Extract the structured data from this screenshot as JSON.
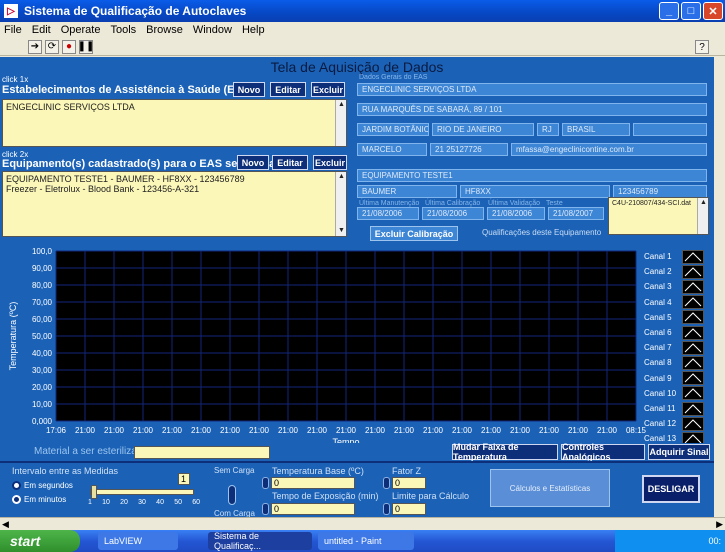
{
  "window": {
    "title": "Sistema de Qualificação de Autoclaves"
  },
  "menu": [
    "File",
    "Edit",
    "Operate",
    "Tools",
    "Browse",
    "Window",
    "Help"
  ],
  "panel": {
    "title": "Tela de Aquisição de Dados",
    "eas": {
      "hint": "click 1x",
      "heading": "Estabelecimentos de Assistência à Saúde (EAS)",
      "buttons": {
        "novo": "Novo",
        "editar": "Editar",
        "excluir": "Excluir"
      },
      "items": [
        "ENGECLINIC SERVIÇOS LTDA"
      ],
      "details_label": "Dados Gerais do EAS",
      "name": "ENGECLINIC SERVIÇOS LTDA",
      "address": "RUA MARQUÊS DE SABARÁ, 89 / 101",
      "district": "JARDIM BOTÂNICO",
      "city": "RIO DE JANEIRO",
      "state": "RJ",
      "country": "BRASIL",
      "contact": "MARCELO",
      "phone": "21 25127726",
      "email": "mfassa@engeclinicontine.com.br"
    },
    "equipment": {
      "hint": "click 2x",
      "heading": "Equipamento(s) cadastrado(s) para o EAS selecionado",
      "buttons": {
        "novo": "Novo",
        "editar": "Editar",
        "excluir": "Excluir"
      },
      "items": [
        "EQUIPAMENTO TESTE1 - BAUMER - HF8XX - 123456789",
        "Freezer - Eletrolux - Blood Bank - 123456-A-321"
      ],
      "name": "EQUIPAMENTO TESTE1",
      "brand": "BAUMER",
      "model": "HF8XX",
      "serial": "123456789",
      "date_labels": [
        "Última Manutenção",
        "Última Calibração",
        "Última Validação",
        "Teste"
      ],
      "dates": [
        "21/08/2006",
        "21/08/2006",
        "21/08/2006",
        "21/08/2007"
      ],
      "file_list": [
        "C4U-210807/434-SCI.dat"
      ],
      "excluir_calibracao": "Excluir Calibração",
      "qualificacoes_label": "Qualificações deste Equipamento"
    }
  },
  "chart_data": {
    "type": "line",
    "ylabel": "Temperatura (ºC)",
    "xlabel": "Tempo",
    "ylim": [
      0,
      100
    ],
    "y_ticks": [
      "0,000",
      "10,00",
      "20,00",
      "30,00",
      "40,00",
      "50,00",
      "60,00",
      "70,00",
      "80,00",
      "90,00",
      "100,0"
    ],
    "x_ticks": [
      "17:06",
      "21:00",
      "21:00",
      "21:00",
      "21:00",
      "21:00",
      "21:00",
      "21:00",
      "21:00",
      "21:00",
      "21:00",
      "21:00",
      "21:00",
      "21:00",
      "21:00",
      "21:00",
      "21:00",
      "21:00",
      "21:00",
      "21:00",
      "08:15"
    ],
    "grid": true,
    "series": [
      {
        "name": "Canal 1",
        "values": []
      },
      {
        "name": "Canal 2",
        "values": []
      },
      {
        "name": "Canal 3",
        "values": []
      },
      {
        "name": "Canal 4",
        "values": []
      },
      {
        "name": "Canal 5",
        "values": []
      },
      {
        "name": "Canal 6",
        "values": []
      },
      {
        "name": "Canal 7",
        "values": []
      },
      {
        "name": "Canal 8",
        "values": []
      },
      {
        "name": "Canal 9",
        "values": []
      },
      {
        "name": "Canal 10",
        "values": []
      },
      {
        "name": "Canal 11",
        "values": []
      },
      {
        "name": "Canal 12",
        "values": []
      },
      {
        "name": "Canal 13",
        "values": []
      }
    ],
    "legend": "right"
  },
  "below_chart": {
    "material_label": "Material a ser esterilizado",
    "material_value": "",
    "btn_faixa": "Mudar Faixa de Temperatura",
    "btn_controles": "Controles Analógicos",
    "btn_adquirir": "Adquirir Sinal"
  },
  "controls": {
    "intervalo_label": "Intervalo entre as Medidas",
    "radio_seg": "Em segundos",
    "radio_min": "Em minutos",
    "slider_value": "1",
    "slider_value_fraction": 0.0,
    "slider_ticks": [
      "1",
      "10",
      "20",
      "30",
      "40",
      "50",
      "60"
    ],
    "sem_carga": "Sem Carga",
    "com_carga": "Com Carga",
    "temp_base_label": "Temperatura Base (ºC)",
    "temp_base_value": "0",
    "tempo_exp_label": "Tempo de Exposição (min)",
    "tempo_exp_value": "0",
    "fator_z_label": "Fator Z",
    "fator_z_value": "0",
    "limite_label": "Limite para Cálculo",
    "limite_value": "0",
    "calc_btn": "Cálculos e Estatísticas",
    "desligar": "DESLIGAR"
  },
  "taskbar": {
    "start": "start",
    "tasks": [
      "LabVIEW",
      "Sistema de Qualificaç...",
      "untitled - Paint"
    ],
    "clock": "00:"
  },
  "colors": {
    "panel": "#1b62b7",
    "field": "#fbf7b8",
    "plot_bg": "#000000",
    "grid": "#12267a"
  }
}
